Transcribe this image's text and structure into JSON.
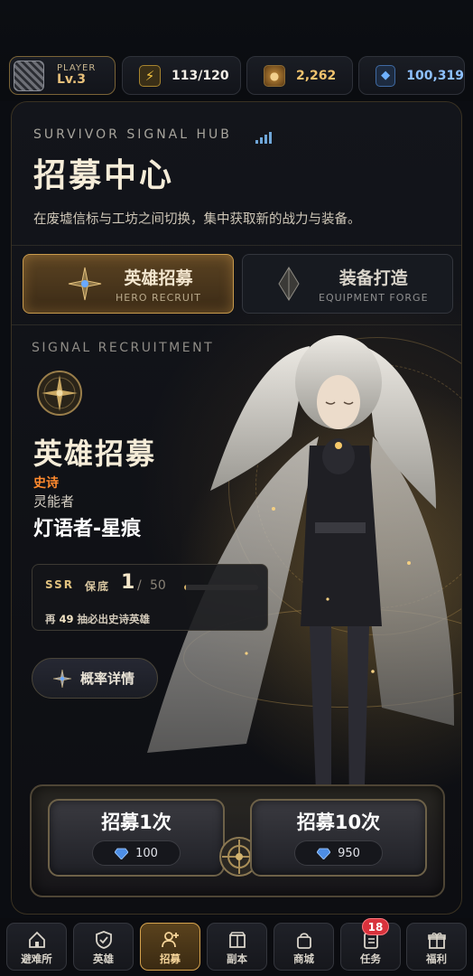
{
  "top_bar": {
    "player_label": "PLAYER",
    "player_level": "Lv.3",
    "energy": "113/120",
    "gold": "2,262",
    "gems": "100,319",
    "icons": {
      "energy": "lightning-icon",
      "gold": "coin-icon",
      "gems": "gem-icon"
    }
  },
  "hub": {
    "title_en": "SURVIVOR SIGNAL HUB",
    "title": "招募中心",
    "subtitle": "在废墟信标与工坊之间切换，集中获取新的战力与装备。"
  },
  "tabs": [
    {
      "label": "英雄招募",
      "label_en": "HERO RECRUIT",
      "active": true
    },
    {
      "label": "装备打造",
      "label_en": "EQUIPMENT FORGE",
      "active": false
    }
  ],
  "banner": {
    "section_en": "SIGNAL RECRUITMENT",
    "title": "英雄招募",
    "rarity": "史诗",
    "hero_class": "灵能者",
    "hero_name": "灯语者-星痕"
  },
  "pity": {
    "rank": "SSR",
    "label": "保底",
    "current": "1",
    "total": "50",
    "progress_fraction": 0.02,
    "note_prefix": "再",
    "note_count": "49",
    "note_suffix": "抽必出史诗英雄"
  },
  "odds_button": {
    "label": "概率详情"
  },
  "recruit": {
    "single": {
      "label": "招募1次",
      "cost": "100"
    },
    "multi": {
      "label": "招募10次",
      "cost": "950"
    }
  },
  "nav": [
    {
      "label": "避难所",
      "icon": "home-icon",
      "active": false,
      "badge": ""
    },
    {
      "label": "英雄",
      "icon": "shield-icon",
      "active": false,
      "badge": ""
    },
    {
      "label": "招募",
      "icon": "add-user-icon",
      "active": true,
      "badge": ""
    },
    {
      "label": "副本",
      "icon": "gate-icon",
      "active": false,
      "badge": ""
    },
    {
      "label": "商城",
      "icon": "shopping-bag-icon",
      "active": false,
      "badge": ""
    },
    {
      "label": "任务",
      "icon": "clipboard-icon",
      "active": false,
      "badge": "18"
    },
    {
      "label": "福利",
      "icon": "gift-icon",
      "active": false,
      "badge": ""
    }
  ],
  "colors": {
    "accent_gold": "#d5a24d",
    "rarity_epic": "#ff8a2e",
    "gem_blue": "#6fb1ff",
    "badge_red": "#d8323c"
  }
}
